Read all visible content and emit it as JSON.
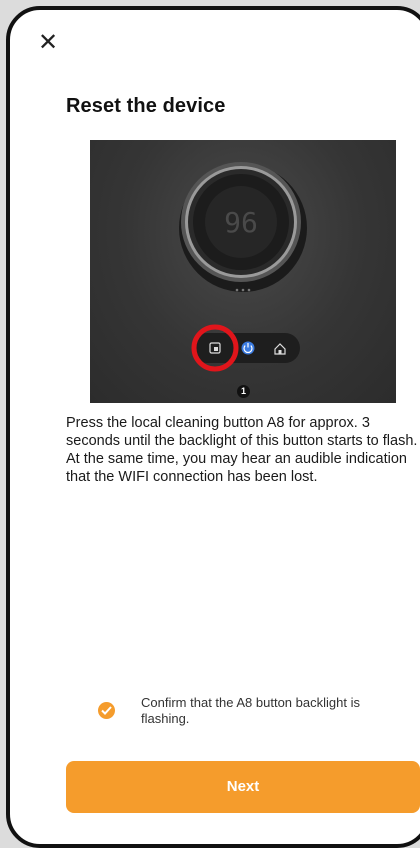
{
  "header": {
    "close_icon": "close-icon",
    "title": "Reset the device"
  },
  "illustration": {
    "dial_display": "96",
    "step_number": "1",
    "buttons": [
      "local-cleaning-icon",
      "power-icon",
      "home-icon"
    ],
    "highlight_color": "#e0151b"
  },
  "instruction": {
    "text": "Press the local cleaning button A8 for approx. 3 seconds until the backlight of this button starts to flash. At the same time, you may hear an audible indication that the WIFI connection has been lost."
  },
  "confirm": {
    "checked": true,
    "label": "Confirm that the A8 button backlight is flashing."
  },
  "footer": {
    "next_label": "Next"
  },
  "colors": {
    "accent": "#f59c2c",
    "text": "#1a1a1a",
    "background": "#ffffff"
  }
}
